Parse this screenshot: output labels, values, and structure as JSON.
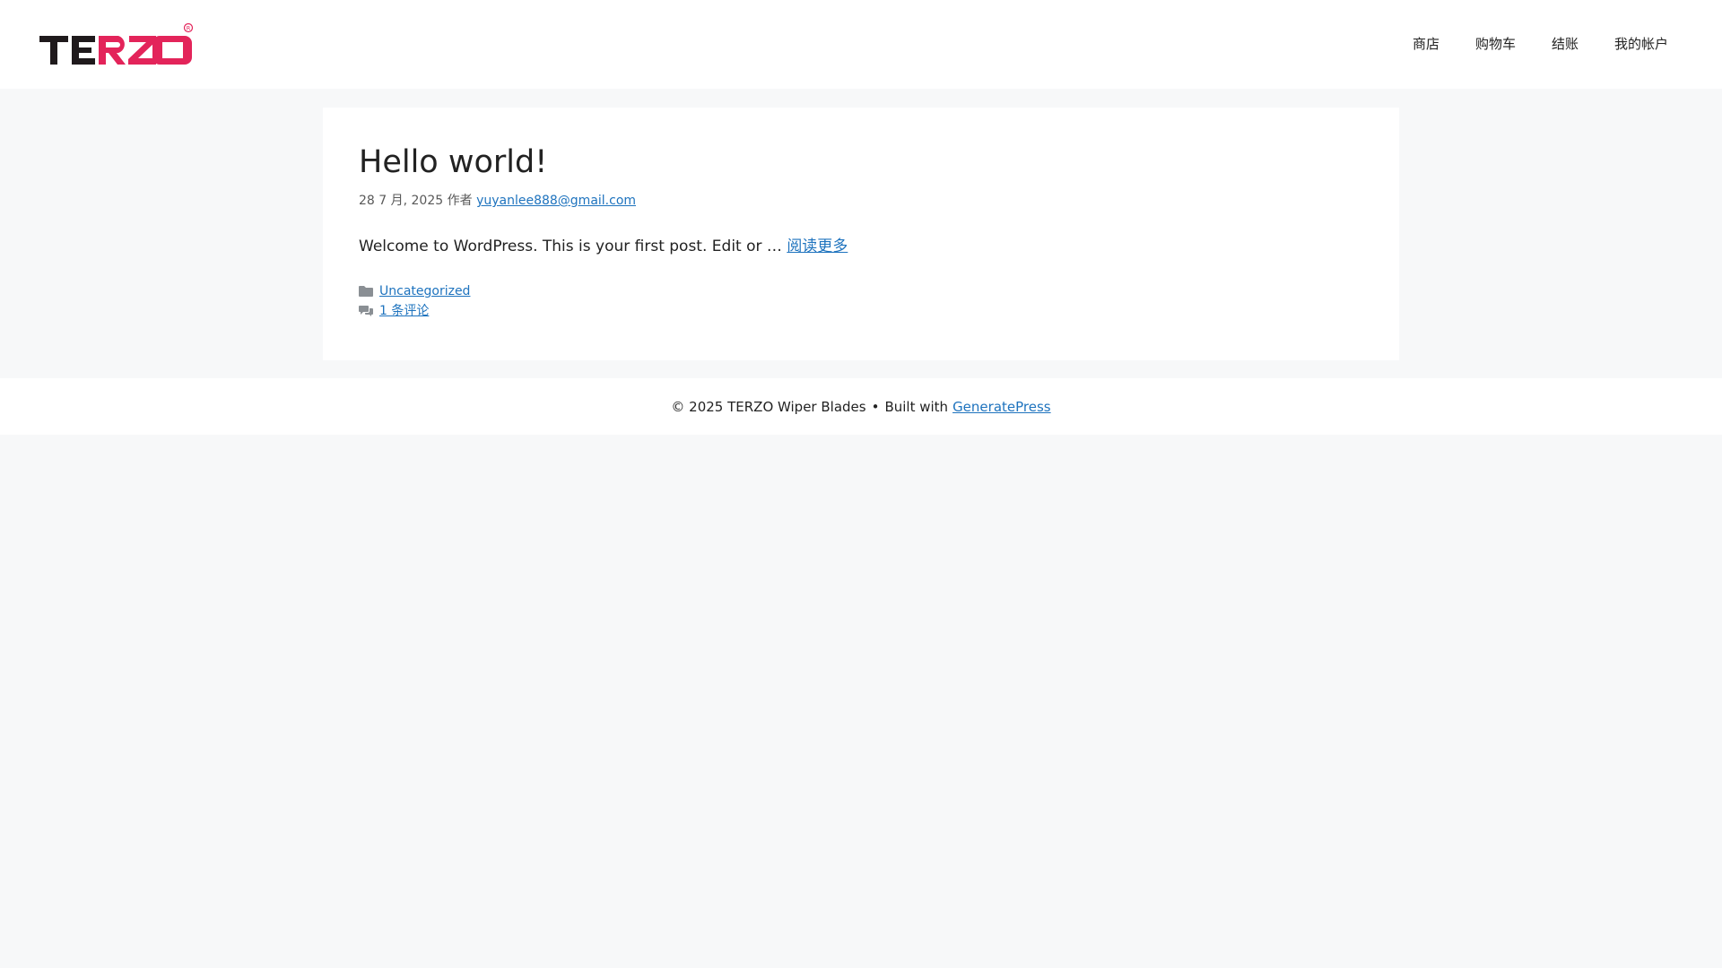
{
  "header": {
    "logo_text": "TERZO",
    "nav": [
      {
        "label": "商店"
      },
      {
        "label": "购物车"
      },
      {
        "label": "结账"
      },
      {
        "label": "我的帐户"
      }
    ]
  },
  "post": {
    "title": "Hello world!",
    "date": "28 7 月, 2025",
    "by_label": "作者",
    "author": "yuyanlee888@gmail.com",
    "summary": "Welcome to WordPress. This is your first post. Edit or …",
    "read_more": "阅读更多",
    "category": "Uncategorized",
    "comments": "1 条评论",
    "icons": [
      "folder-icon",
      "comments-icon"
    ]
  },
  "footer": {
    "copyright": "© 2025 TERZO Wiper Blades",
    "bullet": "•",
    "built_with": "Built with",
    "theme_link": "GeneratePress"
  },
  "colors": {
    "background": "#f7f8f9",
    "link": "#1e73be",
    "logo_dark": "#1f1a1c",
    "logo_accent": "#e3245a"
  }
}
